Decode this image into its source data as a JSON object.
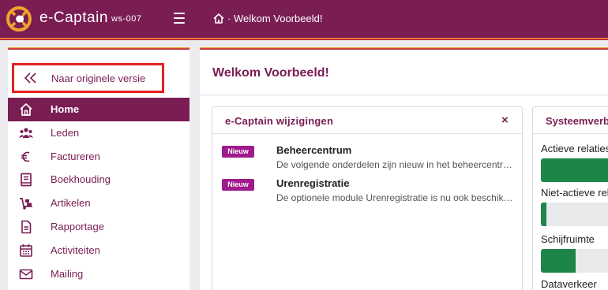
{
  "header": {
    "brand": "e-Captain",
    "workstation": "ws-007",
    "breadcrumb": "· Welkom Voorbeeld!"
  },
  "sidebar": {
    "original_version_label": "Naar originele versie",
    "items": [
      {
        "label": "Home",
        "icon": "home-icon",
        "active": true
      },
      {
        "label": "Leden",
        "icon": "users-icon",
        "active": false
      },
      {
        "label": "Factureren",
        "icon": "euro-icon",
        "active": false
      },
      {
        "label": "Boekhouding",
        "icon": "book-icon",
        "active": false
      },
      {
        "label": "Artikelen",
        "icon": "dolly-icon",
        "active": false
      },
      {
        "label": "Rapportage",
        "icon": "report-icon",
        "active": false
      },
      {
        "label": "Activiteiten",
        "icon": "calendar-icon",
        "active": false
      },
      {
        "label": "Mailing",
        "icon": "envelope-icon",
        "active": false
      }
    ]
  },
  "main": {
    "title": "Welkom Voorbeeld!",
    "changes_card": {
      "title": "e-Captain wijzigingen",
      "close": "×",
      "items": [
        {
          "badge": "Nieuw",
          "title": "Beheercentrum",
          "description": "De volgende onderdelen zijn nieuw in het beheercentrum"
        },
        {
          "badge": "Nieuw",
          "title": "Urenregistratie",
          "description": "De optionele module Urenregistratie is nu ook beschikbaar"
        }
      ]
    },
    "system_card": {
      "title": "Systeemverbruik",
      "metrics": [
        {
          "label": "Actieve relaties",
          "fraction": 1.0
        },
        {
          "label": "Niet-actieve relaties",
          "fraction": 0.06
        },
        {
          "label": "Schijfruimte",
          "fraction": 0.37
        },
        {
          "label": "Dataverkeer",
          "fraction": 0.0
        }
      ]
    }
  },
  "colors": {
    "brand": "#7a1d53",
    "badge": "#a01a8c",
    "progress": "#1e8548",
    "highlight_border": "#e32222"
  }
}
